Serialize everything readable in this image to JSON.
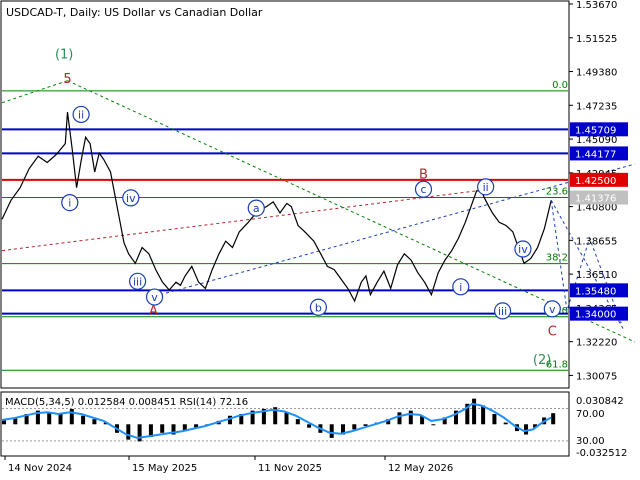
{
  "header": {
    "title": "USDCAD-T, Daily:  US Dollar vs Canadian Dollar"
  },
  "colors": {
    "price": "#000000",
    "blue_level": "#0000cc",
    "red_level": "#e00000",
    "fib": "#008000",
    "green_box": "#00aa00",
    "wave_blue": "#1a3fb4",
    "wave_red": "#b4282e",
    "macd": "#000000",
    "signal": "#1e90ff"
  },
  "chart_data": {
    "type": "line",
    "main": {
      "yticks": [
        "1.53670",
        "1.51525",
        "1.49380",
        "1.47235",
        "1.45090",
        "1.42945",
        "1.40800",
        "1.38655",
        "1.36510",
        "1.34365",
        "1.32220",
        "1.30075"
      ],
      "ylim": [
        1.2953,
        1.5367
      ],
      "xlabels": [
        "14 Nov 2024",
        "15 May 2025",
        "11 Nov 2025",
        "12 May 2026"
      ],
      "levels": [
        {
          "value": "1.45709",
          "kind": "blue"
        },
        {
          "value": "1.44177",
          "kind": "blue"
        },
        {
          "value": "1.42500",
          "kind": "red"
        },
        {
          "value": "1.41376",
          "kind": "gray"
        },
        {
          "value": "1.35480",
          "kind": "blue"
        },
        {
          "value": "1.34000",
          "kind": "blue"
        }
      ],
      "fib_labels": [
        {
          "text": "0.0",
          "price": 1.4815
        },
        {
          "text": "23.6",
          "price": 1.4138
        },
        {
          "text": "38.2",
          "price": 1.3718
        },
        {
          "text": "50.0",
          "price": 1.338
        },
        {
          "text": "61.8",
          "price": 1.304
        }
      ],
      "wave_labels": [
        {
          "text": "(1)",
          "color": "green"
        },
        {
          "text": "5",
          "color": "red"
        },
        {
          "text": "ii",
          "color": "blue"
        },
        {
          "text": "i",
          "color": "blue"
        },
        {
          "text": "iv",
          "color": "blue"
        },
        {
          "text": "iii",
          "color": "blue"
        },
        {
          "text": "v",
          "color": "blue"
        },
        {
          "text": "A",
          "color": "red"
        },
        {
          "text": "a",
          "color": "blue"
        },
        {
          "text": "b",
          "color": "blue"
        },
        {
          "text": "B",
          "color": "red"
        },
        {
          "text": "c",
          "color": "blue"
        },
        {
          "text": "ii",
          "color": "blue"
        },
        {
          "text": "i",
          "color": "blue"
        },
        {
          "text": "iv",
          "color": "blue"
        },
        {
          "text": "iii",
          "color": "blue"
        },
        {
          "text": "v",
          "color": "blue"
        },
        {
          "text": "C",
          "color": "red"
        },
        {
          "text": "(2)",
          "color": "green"
        }
      ],
      "price_series": [
        [
          0,
          1.4
        ],
        [
          8,
          1.412
        ],
        [
          16,
          1.42
        ],
        [
          24,
          1.432
        ],
        [
          32,
          1.44
        ],
        [
          40,
          1.436
        ],
        [
          48,
          1.441
        ],
        [
          56,
          1.448
        ],
        [
          58,
          1.468
        ],
        [
          62,
          1.445
        ],
        [
          66,
          1.42
        ],
        [
          70,
          1.437
        ],
        [
          74,
          1.452
        ],
        [
          78,
          1.448
        ],
        [
          82,
          1.43
        ],
        [
          86,
          1.442
        ],
        [
          90,
          1.438
        ],
        [
          96,
          1.43
        ],
        [
          100,
          1.415
        ],
        [
          104,
          1.4
        ],
        [
          108,
          1.385
        ],
        [
          112,
          1.378
        ],
        [
          118,
          1.372
        ],
        [
          124,
          1.382
        ],
        [
          130,
          1.378
        ],
        [
          136,
          1.368
        ],
        [
          142,
          1.36
        ],
        [
          148,
          1.355
        ],
        [
          154,
          1.36
        ],
        [
          158,
          1.358
        ],
        [
          162,
          1.364
        ],
        [
          168,
          1.37
        ],
        [
          174,
          1.36
        ],
        [
          180,
          1.356
        ],
        [
          186,
          1.368
        ],
        [
          192,
          1.378
        ],
        [
          198,
          1.386
        ],
        [
          204,
          1.382
        ],
        [
          210,
          1.392
        ],
        [
          218,
          1.398
        ],
        [
          226,
          1.405
        ],
        [
          234,
          1.408
        ],
        [
          240,
          1.411
        ],
        [
          246,
          1.404
        ],
        [
          252,
          1.41
        ],
        [
          256,
          1.408
        ],
        [
          262,
          1.396
        ],
        [
          268,
          1.392
        ],
        [
          276,
          1.386
        ],
        [
          282,
          1.378
        ],
        [
          288,
          1.37
        ],
        [
          294,
          1.368
        ],
        [
          300,
          1.362
        ],
        [
          306,
          1.356
        ],
        [
          312,
          1.348
        ],
        [
          318,
          1.36
        ],
        [
          322,
          1.364
        ],
        [
          326,
          1.352
        ],
        [
          332,
          1.36
        ],
        [
          338,
          1.367
        ],
        [
          344,
          1.356
        ],
        [
          350,
          1.371
        ],
        [
          356,
          1.378
        ],
        [
          362,
          1.374
        ],
        [
          368,
          1.366
        ],
        [
          374,
          1.36
        ],
        [
          380,
          1.352
        ],
        [
          386,
          1.366
        ],
        [
          392,
          1.374
        ],
        [
          398,
          1.38
        ],
        [
          404,
          1.388
        ],
        [
          410,
          1.398
        ],
        [
          416,
          1.41
        ],
        [
          420,
          1.418
        ],
        [
          424,
          1.418
        ],
        [
          428,
          1.412
        ],
        [
          434,
          1.404
        ],
        [
          440,
          1.398
        ],
        [
          446,
          1.396
        ],
        [
          452,
          1.392
        ],
        [
          458,
          1.38
        ],
        [
          462,
          1.372
        ],
        [
          468,
          1.375
        ],
        [
          474,
          1.382
        ],
        [
          480,
          1.394
        ],
        [
          486,
          1.412
        ]
      ],
      "projection": [
        [
          486,
          1.412
        ],
        [
          500,
          1.342
        ],
        [
          520,
          1.388
        ],
        [
          548,
          1.334
        ]
      ],
      "proj2": [
        [
          486,
          1.412
        ],
        [
          550,
          1.33
        ]
      ]
    },
    "indicator": {
      "label": "MACD(5,34,5) 0.012584 0.008451 RSI(14) 72.16",
      "yticks": [
        "0.030842",
        "70.00",
        "30.00",
        "-0.032512"
      ],
      "macd_series": [
        [
          0,
          0.006
        ],
        [
          10,
          0.008
        ],
        [
          20,
          0.012
        ],
        [
          30,
          0.016
        ],
        [
          40,
          0.014
        ],
        [
          50,
          0.012
        ],
        [
          60,
          0.018
        ],
        [
          70,
          0.01
        ],
        [
          80,
          0.006
        ],
        [
          90,
          0.002
        ],
        [
          100,
          -0.01
        ],
        [
          110,
          -0.018
        ],
        [
          120,
          -0.02
        ],
        [
          130,
          -0.015
        ],
        [
          140,
          -0.01
        ],
        [
          150,
          -0.012
        ],
        [
          160,
          -0.008
        ],
        [
          170,
          -0.004
        ],
        [
          180,
          0.0
        ],
        [
          190,
          0.004
        ],
        [
          200,
          0.01
        ],
        [
          210,
          0.012
        ],
        [
          220,
          0.016
        ],
        [
          230,
          0.018
        ],
        [
          240,
          0.02
        ],
        [
          250,
          0.014
        ],
        [
          260,
          0.006
        ],
        [
          270,
          -0.004
        ],
        [
          280,
          -0.01
        ],
        [
          290,
          -0.016
        ],
        [
          300,
          -0.012
        ],
        [
          310,
          -0.006
        ],
        [
          320,
          -0.002
        ],
        [
          330,
          0.002
        ],
        [
          340,
          0.006
        ],
        [
          350,
          0.014
        ],
        [
          360,
          0.016
        ],
        [
          370,
          0.01
        ],
        [
          380,
          0.0
        ],
        [
          390,
          0.008
        ],
        [
          400,
          0.016
        ],
        [
          410,
          0.024
        ],
        [
          416,
          0.03
        ],
        [
          424,
          0.022
        ],
        [
          434,
          0.012
        ],
        [
          444,
          0.002
        ],
        [
          454,
          -0.008
        ],
        [
          462,
          -0.012
        ],
        [
          470,
          -0.004
        ],
        [
          478,
          0.008
        ],
        [
          486,
          0.013
        ]
      ],
      "signal_series": [
        [
          0,
          0.005
        ],
        [
          10,
          0.007
        ],
        [
          20,
          0.01
        ],
        [
          30,
          0.013
        ],
        [
          40,
          0.014
        ],
        [
          50,
          0.012
        ],
        [
          60,
          0.014
        ],
        [
          70,
          0.012
        ],
        [
          80,
          0.008
        ],
        [
          90,
          0.004
        ],
        [
          100,
          -0.004
        ],
        [
          110,
          -0.012
        ],
        [
          120,
          -0.016
        ],
        [
          130,
          -0.014
        ],
        [
          140,
          -0.012
        ],
        [
          150,
          -0.01
        ],
        [
          160,
          -0.008
        ],
        [
          170,
          -0.005
        ],
        [
          180,
          -0.002
        ],
        [
          190,
          0.002
        ],
        [
          200,
          0.006
        ],
        [
          210,
          0.01
        ],
        [
          220,
          0.013
        ],
        [
          230,
          0.015
        ],
        [
          240,
          0.017
        ],
        [
          250,
          0.015
        ],
        [
          260,
          0.01
        ],
        [
          270,
          0.003
        ],
        [
          280,
          -0.004
        ],
        [
          290,
          -0.01
        ],
        [
          300,
          -0.011
        ],
        [
          310,
          -0.008
        ],
        [
          320,
          -0.004
        ],
        [
          330,
          0.0
        ],
        [
          340,
          0.004
        ],
        [
          350,
          0.009
        ],
        [
          360,
          0.012
        ],
        [
          370,
          0.011
        ],
        [
          380,
          0.004
        ],
        [
          390,
          0.006
        ],
        [
          400,
          0.011
        ],
        [
          410,
          0.018
        ],
        [
          416,
          0.024
        ],
        [
          424,
          0.022
        ],
        [
          434,
          0.016
        ],
        [
          444,
          0.008
        ],
        [
          454,
          -0.002
        ],
        [
          462,
          -0.008
        ],
        [
          470,
          -0.006
        ],
        [
          478,
          0.002
        ],
        [
          486,
          0.008
        ]
      ]
    }
  }
}
